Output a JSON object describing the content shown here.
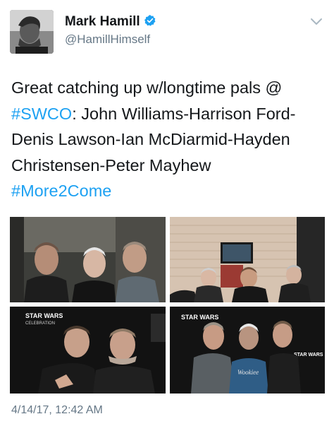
{
  "author": {
    "display_name": "Mark Hamill",
    "handle": "@HamillHimself",
    "verified": true,
    "avatar_icon": "profile-photo"
  },
  "tweet": {
    "lines": [
      [
        "Great catching up w/longtime pals @"
      ],
      [
        "#SWCO",
        ": John Williams-Harrison Ford-"
      ],
      [
        "Denis Lawson-Ian McDiarmid-Hayden"
      ],
      [
        "Christensen-Peter Mayhew"
      ],
      [
        "#More2Come"
      ]
    ],
    "hashtags": [
      "#SWCO",
      "#More2Come"
    ]
  },
  "photos": {
    "count": 4,
    "backdrop_text": {
      "star_wars": "STAR WARS",
      "celebration": "CELEBRATION",
      "shirt": "Wookiee"
    }
  },
  "timestamp": "4/14/17, 12:42 AM",
  "colors": {
    "link": "#1da1f2",
    "secondary_text": "#657786",
    "verified_badge": "#1da1f2",
    "text": "#14171a"
  },
  "icons": {
    "verified": "verified-badge-icon",
    "more": "chevron-down-icon"
  }
}
